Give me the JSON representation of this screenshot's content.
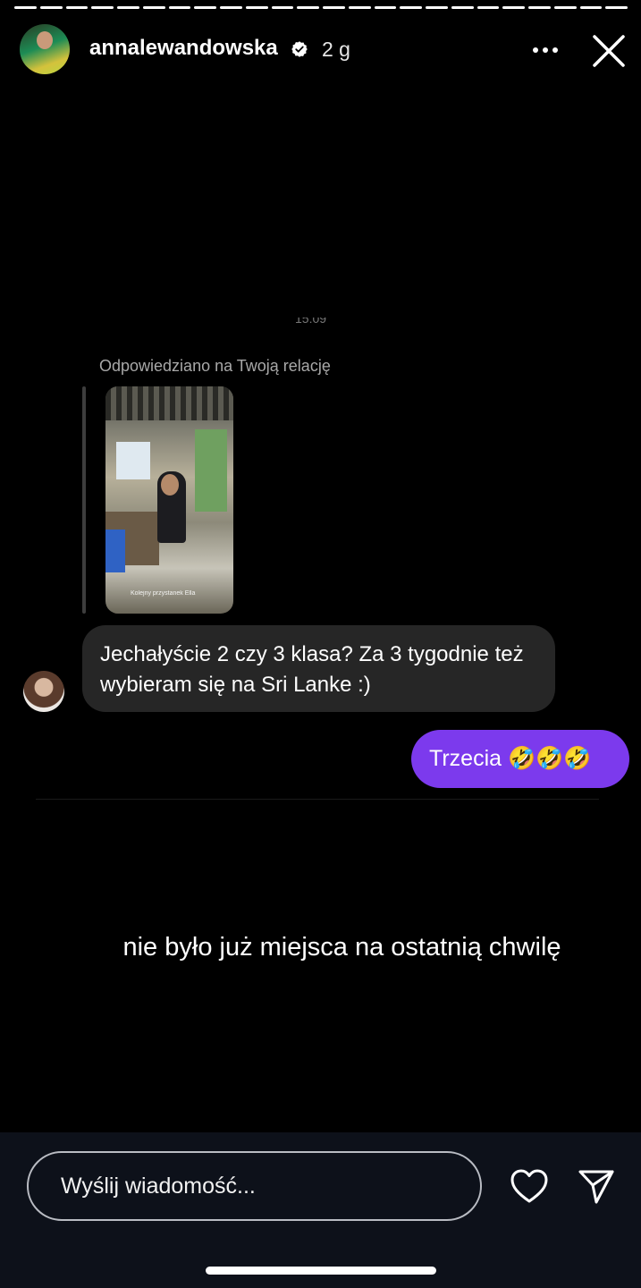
{
  "story": {
    "progress": {
      "total_segments": 24,
      "completed_segments": 24
    },
    "username": "annalewandowska",
    "verified": true,
    "time_ago": "2 g"
  },
  "chat": {
    "timestamp_hidden": "15:09",
    "replied_label": "Odpowiedziano na Twoją relację",
    "story_thumbnail_caption": "Kolejny przystanek Ella",
    "incoming_message": "Jechałyście 2 czy 3 klasa? Za 3 tygodnie też wybieram się na Sri Lanke :)",
    "outgoing_message": "Trzecia 🤣🤣🤣"
  },
  "story_caption": "nie było już miejsca na ostatnią chwilę",
  "reply_bar": {
    "placeholder": "Wyślij wiadomość..."
  },
  "icons": {
    "more": "more-horizontal-icon",
    "close": "close-icon",
    "like": "heart-icon",
    "send": "send-icon"
  },
  "colors": {
    "outgoing_bubble": "#7c3aed",
    "incoming_bubble": "#262626",
    "background": "#000000",
    "bottom_area": "#0d111a"
  }
}
